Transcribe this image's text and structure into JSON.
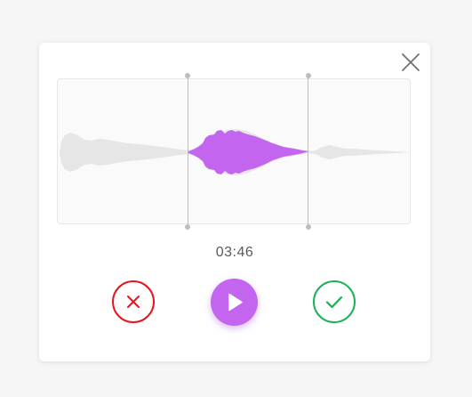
{
  "player": {
    "time": "03:46",
    "selection": {
      "start": 0.37,
      "end": 0.71
    }
  },
  "icons": {
    "close": "close-icon",
    "cancel": "x-icon",
    "play": "play-icon",
    "confirm": "checkmark-icon"
  },
  "colors": {
    "selected_wave": "#c465ef",
    "unselected_wave": "#e6e6e6",
    "cancel": "#e8151e",
    "play": "#c465ef",
    "confirm": "#1cb158",
    "close": "#707070"
  }
}
